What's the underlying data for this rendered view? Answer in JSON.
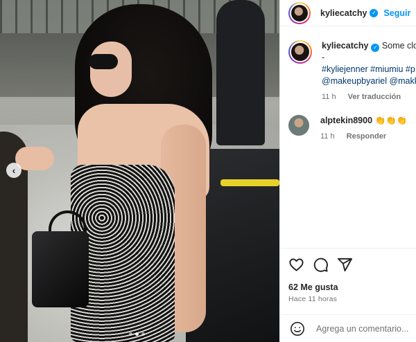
{
  "post": {
    "username": "kyliecatchy",
    "follow_label": "Seguir",
    "verified_symbol": "✓",
    "caption": {
      "username": "kyliecatchy",
      "text": "Some close",
      "line2": "-",
      "hashtags_line": "#kyliejenner #miumiu #p",
      "mentions_line": "@makeupbyariel @makk",
      "time": "11 h",
      "translate_label": "Ver traducción"
    },
    "comments": [
      {
        "username": "alptekin8900",
        "text": "👏👏👏",
        "time": "11 h",
        "reply_label": "Responder"
      }
    ],
    "likes": "62 Me gusta",
    "posted_ago": "Hace 11 horas",
    "comment_placeholder": "Agrega un comentario..."
  },
  "carousel": {
    "prev_label": "‹",
    "slide": 2,
    "slides": 3
  },
  "colors": {
    "accent": "#0095f6",
    "link": "#00376b",
    "muted": "#737373"
  },
  "icons": [
    "chevron-left-icon",
    "heart-icon",
    "comment-icon",
    "share-icon",
    "emoji-icon",
    "verified-icon"
  ]
}
